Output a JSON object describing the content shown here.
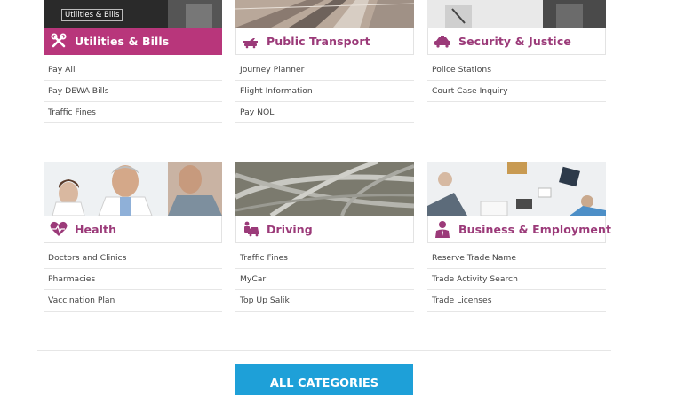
{
  "tooltip": "Utilities & Bills",
  "categories": [
    {
      "title": "Utilities & Bills",
      "links": [
        "Pay All",
        "Pay DEWA Bills",
        "Traffic Fines"
      ]
    },
    {
      "title": "Public Transport",
      "links": [
        "Journey Planner",
        "Flight Information",
        "Pay NOL"
      ]
    },
    {
      "title": "Security & Justice",
      "links": [
        "Police Stations",
        "Court Case Inquiry"
      ]
    },
    {
      "title": "Health",
      "links": [
        "Doctors and Clinics",
        "Pharmacies",
        "Vaccination Plan"
      ]
    },
    {
      "title": "Driving",
      "links": [
        "Traffic Fines",
        "MyCar",
        "Top Up Salik"
      ]
    },
    {
      "title": "Business & Employment",
      "links": [
        "Reserve Trade Name",
        "Trade Activity Search",
        "Trade Licenses"
      ]
    }
  ],
  "all_categories_label": "ALL CATEGORIES",
  "colors": {
    "accent": "#b8367b",
    "title": "#9b3a79",
    "button": "#1ea0d8"
  }
}
